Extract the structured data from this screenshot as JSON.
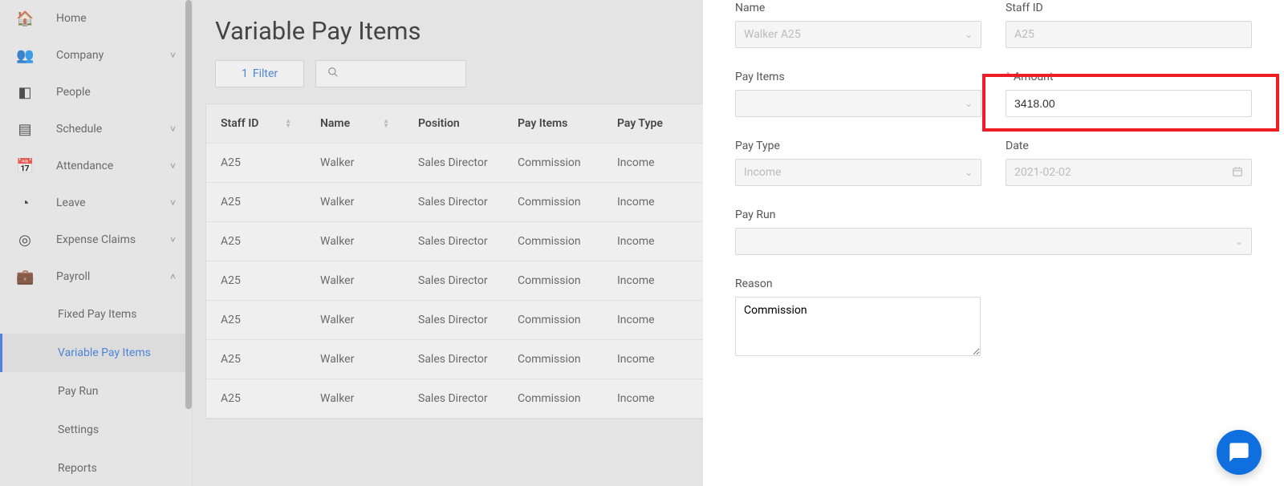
{
  "sidebar": {
    "items": [
      {
        "label": "Home",
        "icon": "🏠"
      },
      {
        "label": "Company",
        "icon": "👥",
        "expandable": true
      },
      {
        "label": "People",
        "icon": "◧"
      },
      {
        "label": "Schedule",
        "icon": "▤",
        "expandable": true
      },
      {
        "label": "Attendance",
        "icon": "📅",
        "expandable": true
      },
      {
        "label": "Leave",
        "icon": "◔",
        "expandable": true
      },
      {
        "label": "Expense Claims",
        "icon": "◎",
        "expandable": true
      },
      {
        "label": "Payroll",
        "icon": "💼",
        "expandable": true,
        "expanded": true
      }
    ],
    "payroll_sub": [
      {
        "label": "Fixed Pay Items"
      },
      {
        "label": "Variable Pay Items",
        "active": true
      },
      {
        "label": "Pay Run"
      },
      {
        "label": "Settings"
      },
      {
        "label": "Reports"
      }
    ]
  },
  "page": {
    "title": "Variable Pay Items",
    "filter_count": "1",
    "filter_label": "Filter"
  },
  "table": {
    "headers": {
      "staff_id": "Staff ID",
      "name": "Name",
      "position": "Position",
      "pay_items": "Pay Items",
      "pay_type": "Pay Type"
    },
    "rows": [
      {
        "staff_id": "A25",
        "name": "Walker",
        "position": "Sales Director",
        "pay_items": "Commission",
        "pay_type": "Income"
      },
      {
        "staff_id": "A25",
        "name": "Walker",
        "position": "Sales Director",
        "pay_items": "Commission",
        "pay_type": "Income"
      },
      {
        "staff_id": "A25",
        "name": "Walker",
        "position": "Sales Director",
        "pay_items": "Commission",
        "pay_type": "Income"
      },
      {
        "staff_id": "A25",
        "name": "Walker",
        "position": "Sales Director",
        "pay_items": "Commission",
        "pay_type": "Income"
      },
      {
        "staff_id": "A25",
        "name": "Walker",
        "position": "Sales Director",
        "pay_items": "Commission",
        "pay_type": "Income"
      },
      {
        "staff_id": "A25",
        "name": "Walker",
        "position": "Sales Director",
        "pay_items": "Commission",
        "pay_type": "Income"
      },
      {
        "staff_id": "A25",
        "name": "Walker",
        "position": "Sales Director",
        "pay_items": "Commission",
        "pay_type": "Income"
      }
    ]
  },
  "form": {
    "name_label": "Name",
    "name_value": "Walker A25",
    "staffid_label": "Staff ID",
    "staffid_value": "A25",
    "payitems_label": "Pay Items",
    "amount_label": "Amount",
    "amount_value": "3418.00",
    "paytype_label": "Pay Type",
    "paytype_value": "Income",
    "date_label": "Date",
    "date_value": "2021-02-02",
    "payrun_label": "Pay Run",
    "reason_label": "Reason",
    "reason_value": "Commission"
  }
}
